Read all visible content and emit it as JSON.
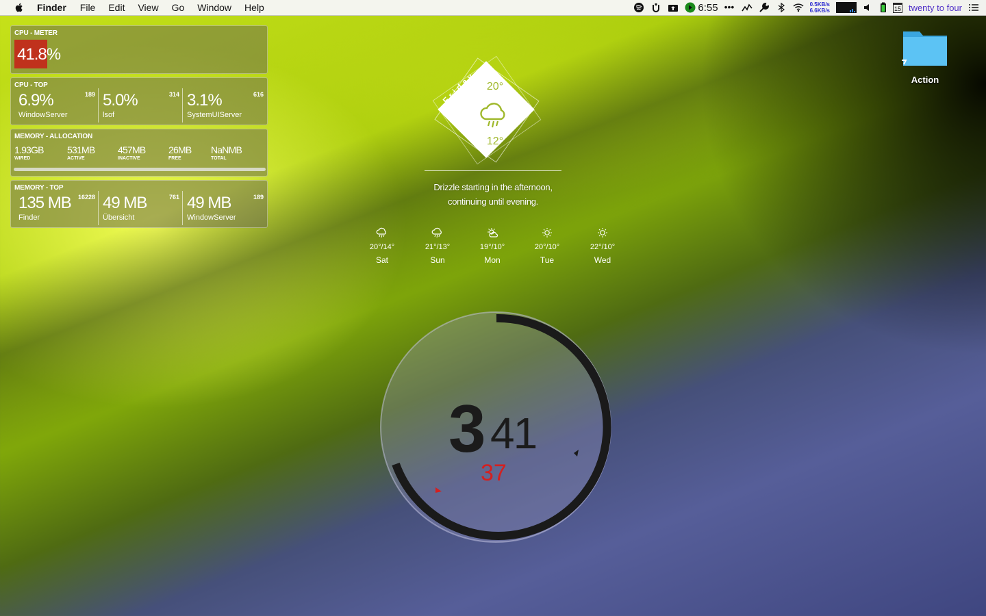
{
  "menubar": {
    "app_name": "Finder",
    "menus": [
      "File",
      "Edit",
      "View",
      "Go",
      "Window",
      "Help"
    ],
    "clock_time": "6:55",
    "net_up": "0.5KB/s",
    "net_down": "6.6KB/s",
    "calendar_day": "15",
    "fuzzy_time": "twenty to four",
    "icons": [
      "apple-icon",
      "spotify-icon",
      "utorrent-icon",
      "upload-icon",
      "play-icon",
      "more-icon",
      "activity-icon",
      "tools-icon",
      "bluetooth-icon",
      "wifi-icon",
      "cpu-graph",
      "volume-icon",
      "battery-icon",
      "calendar-icon",
      "list-icon"
    ]
  },
  "cpu_meter": {
    "title": "CPU - METER",
    "value": "41.8%",
    "color": "#c0311c"
  },
  "cpu_top": {
    "title": "CPU - TOP",
    "processes": [
      {
        "value": "6.9%",
        "name": "WindowServer",
        "pid": "189"
      },
      {
        "value": "5.0%",
        "name": "lsof",
        "pid": "314"
      },
      {
        "value": "3.1%",
        "name": "SystemUIServer",
        "pid": "616"
      }
    ]
  },
  "memory_allocation": {
    "title": "MEMORY - ALLOCATION",
    "items": [
      {
        "value": "1.93GB",
        "label": "WIRED"
      },
      {
        "value": "531MB",
        "label": "ACTIVE"
      },
      {
        "value": "457MB",
        "label": "INACTIVE"
      },
      {
        "value": "26MB",
        "label": "FREE"
      },
      {
        "value": "NaNMB",
        "label": "TOTAL"
      }
    ]
  },
  "memory_top": {
    "title": "MEMORY - TOP",
    "processes": [
      {
        "value": "135 MB",
        "name": "Finder",
        "pid": "16228"
      },
      {
        "value": "49 MB",
        "name": "Übersicht",
        "pid": "761"
      },
      {
        "value": "49 MB",
        "name": "WindowServer",
        "pid": "189"
      }
    ]
  },
  "weather": {
    "day": "Friday",
    "high": "20°",
    "low": "12°",
    "summary_line1": "Drizzle starting in the afternoon,",
    "summary_line2": "continuing until evening.",
    "forecast": [
      {
        "temp": "20°/14°",
        "day": "Sat",
        "icon": "rain-icon"
      },
      {
        "temp": "21°/13°",
        "day": "Sun",
        "icon": "rain-icon"
      },
      {
        "temp": "19°/10°",
        "day": "Mon",
        "icon": "partly-cloudy-icon"
      },
      {
        "temp": "20°/10°",
        "day": "Tue",
        "icon": "sun-icon"
      },
      {
        "temp": "22°/10°",
        "day": "Wed",
        "icon": "sun-icon"
      }
    ]
  },
  "clock": {
    "hour": "3",
    "minute": "41",
    "second": "37",
    "second_color": "#d42020"
  },
  "desktop": {
    "folder_label": "Action",
    "folder_color": "#4fb8f0"
  }
}
